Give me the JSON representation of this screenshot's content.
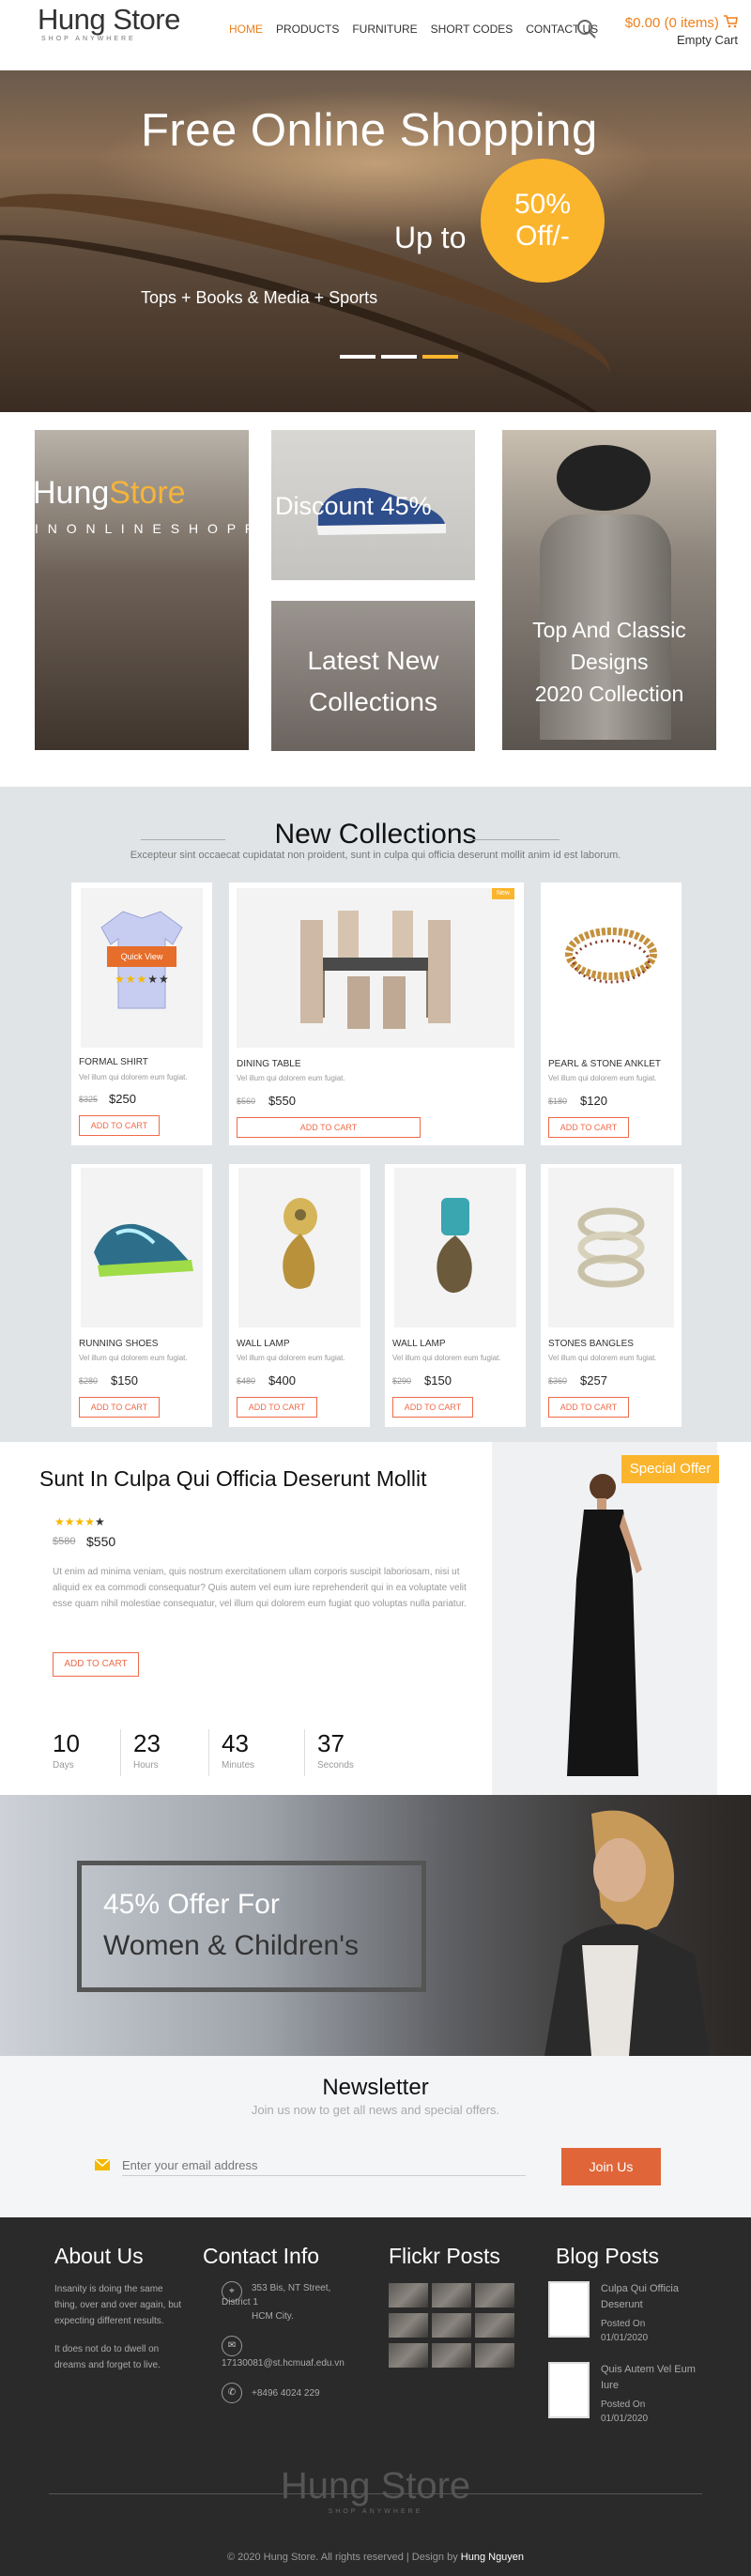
{
  "header": {
    "logo_main": "Hung Store",
    "logo_sub": "SHOP ANYWHERE",
    "nav": [
      "HOME",
      "PRODUCTS",
      "FURNITURE",
      "SHORT CODES",
      "CONTACT US"
    ],
    "cart_amount": "$0.00 (0 items)",
    "cart_status": "Empty Cart",
    "accent_color": "#ef7f1a"
  },
  "hero": {
    "title": "Free Online Shopping",
    "upto": "Up to",
    "circle_line1": "50%",
    "circle_line2": "Off/-",
    "categories": "Tops + Books & Media + Sports"
  },
  "promos": {
    "p1_brand_a": "Hung",
    "p1_brand_b": "Store",
    "p1_tag": "I N O N L I N E S H O P P I N G",
    "p2_text": "Discount 45%",
    "p3_line1": "Latest New",
    "p3_line2": "Collections",
    "p4_line1": "Top And Classic",
    "p4_line2": "Designs",
    "p4_line3": "2020 Collection"
  },
  "collections": {
    "title": "New Collections",
    "subtitle": "Excepteur sint occaecat cupidatat non proident, sunt in culpa qui officia deserunt mollit anim id est laborum.",
    "quick_view": "Quick View",
    "new_badge": "New",
    "desc": "Vel illum qui dolorem eum fugiat.",
    "add_to_cart": "ADD TO CART",
    "items": [
      {
        "name": "FORMAL SHIRT",
        "old": "$325",
        "price": "$250"
      },
      {
        "name": "DINING TABLE",
        "old": "$560",
        "price": "$550"
      },
      {
        "name": "PEARL & STONE ANKLET",
        "old": "$180",
        "price": "$120"
      },
      {
        "name": "RUNNING SHOES",
        "old": "$280",
        "price": "$150"
      },
      {
        "name": "WALL LAMP",
        "old": "$480",
        "price": "$400"
      },
      {
        "name": "WALL LAMP",
        "old": "$290",
        "price": "$150"
      },
      {
        "name": "STONES BANGLES",
        "old": "$360",
        "price": "$257"
      }
    ]
  },
  "special": {
    "badge": "Special Offer",
    "title": "Sunt In Culpa Qui Officia Deserunt Mollit",
    "old": "$580",
    "price": "$550",
    "body": "Ut enim ad minima veniam, quis nostrum exercitationem ullam corporis suscipit laboriosam, nisi ut aliquid ex ea commodi consequatur? Quis autem vel eum iure reprehenderit qui in ea voluptate velit esse quam nihil molestiae consequatur, vel illum qui dolorem eum fugiat quo voluptas nulla pariatur.",
    "button": "ADD TO CART",
    "countdown": [
      {
        "n": "10",
        "u": "Days"
      },
      {
        "n": "23",
        "u": "Hours"
      },
      {
        "n": "43",
        "u": "Minutes"
      },
      {
        "n": "37",
        "u": "Seconds"
      }
    ]
  },
  "banner": {
    "line1": "45% Offer For",
    "line2": "Women & Children's"
  },
  "newsletter": {
    "title": "Newsletter",
    "subtitle": "Join us now to get all news and special offers.",
    "placeholder": "Enter your email address",
    "button": "Join Us"
  },
  "footer": {
    "about_title": "About Us",
    "about_p1": "Insanity is doing the same thing, over and over again, but expecting different results.",
    "about_p2": "It does not do to dwell on dreams and forget to live.",
    "contact_title": "Contact Info",
    "address_l1": "353 Bis, NT Street,",
    "address_l2": "District 1",
    "address_l3": "HCM City.",
    "email": "17130081@st.hcmuaf.edu.vn",
    "phone": "+8496 4024 229",
    "flickr_title": "Flickr Posts",
    "blog_title": "Blog Posts",
    "posts": [
      {
        "title": "Culpa Qui Officia Deserunt",
        "posted": "Posted On",
        "date": "01/01/2020"
      },
      {
        "title": "Quis Autem Vel Eum Iure",
        "posted": "Posted On",
        "date": "01/01/2020"
      }
    ],
    "logo_main": "Hung Store",
    "logo_sub": "SHOP ANYWHERE",
    "copyright": "© 2020 Hung Store. All rights reserved | Design by",
    "designer": "Hung Nguyen"
  }
}
